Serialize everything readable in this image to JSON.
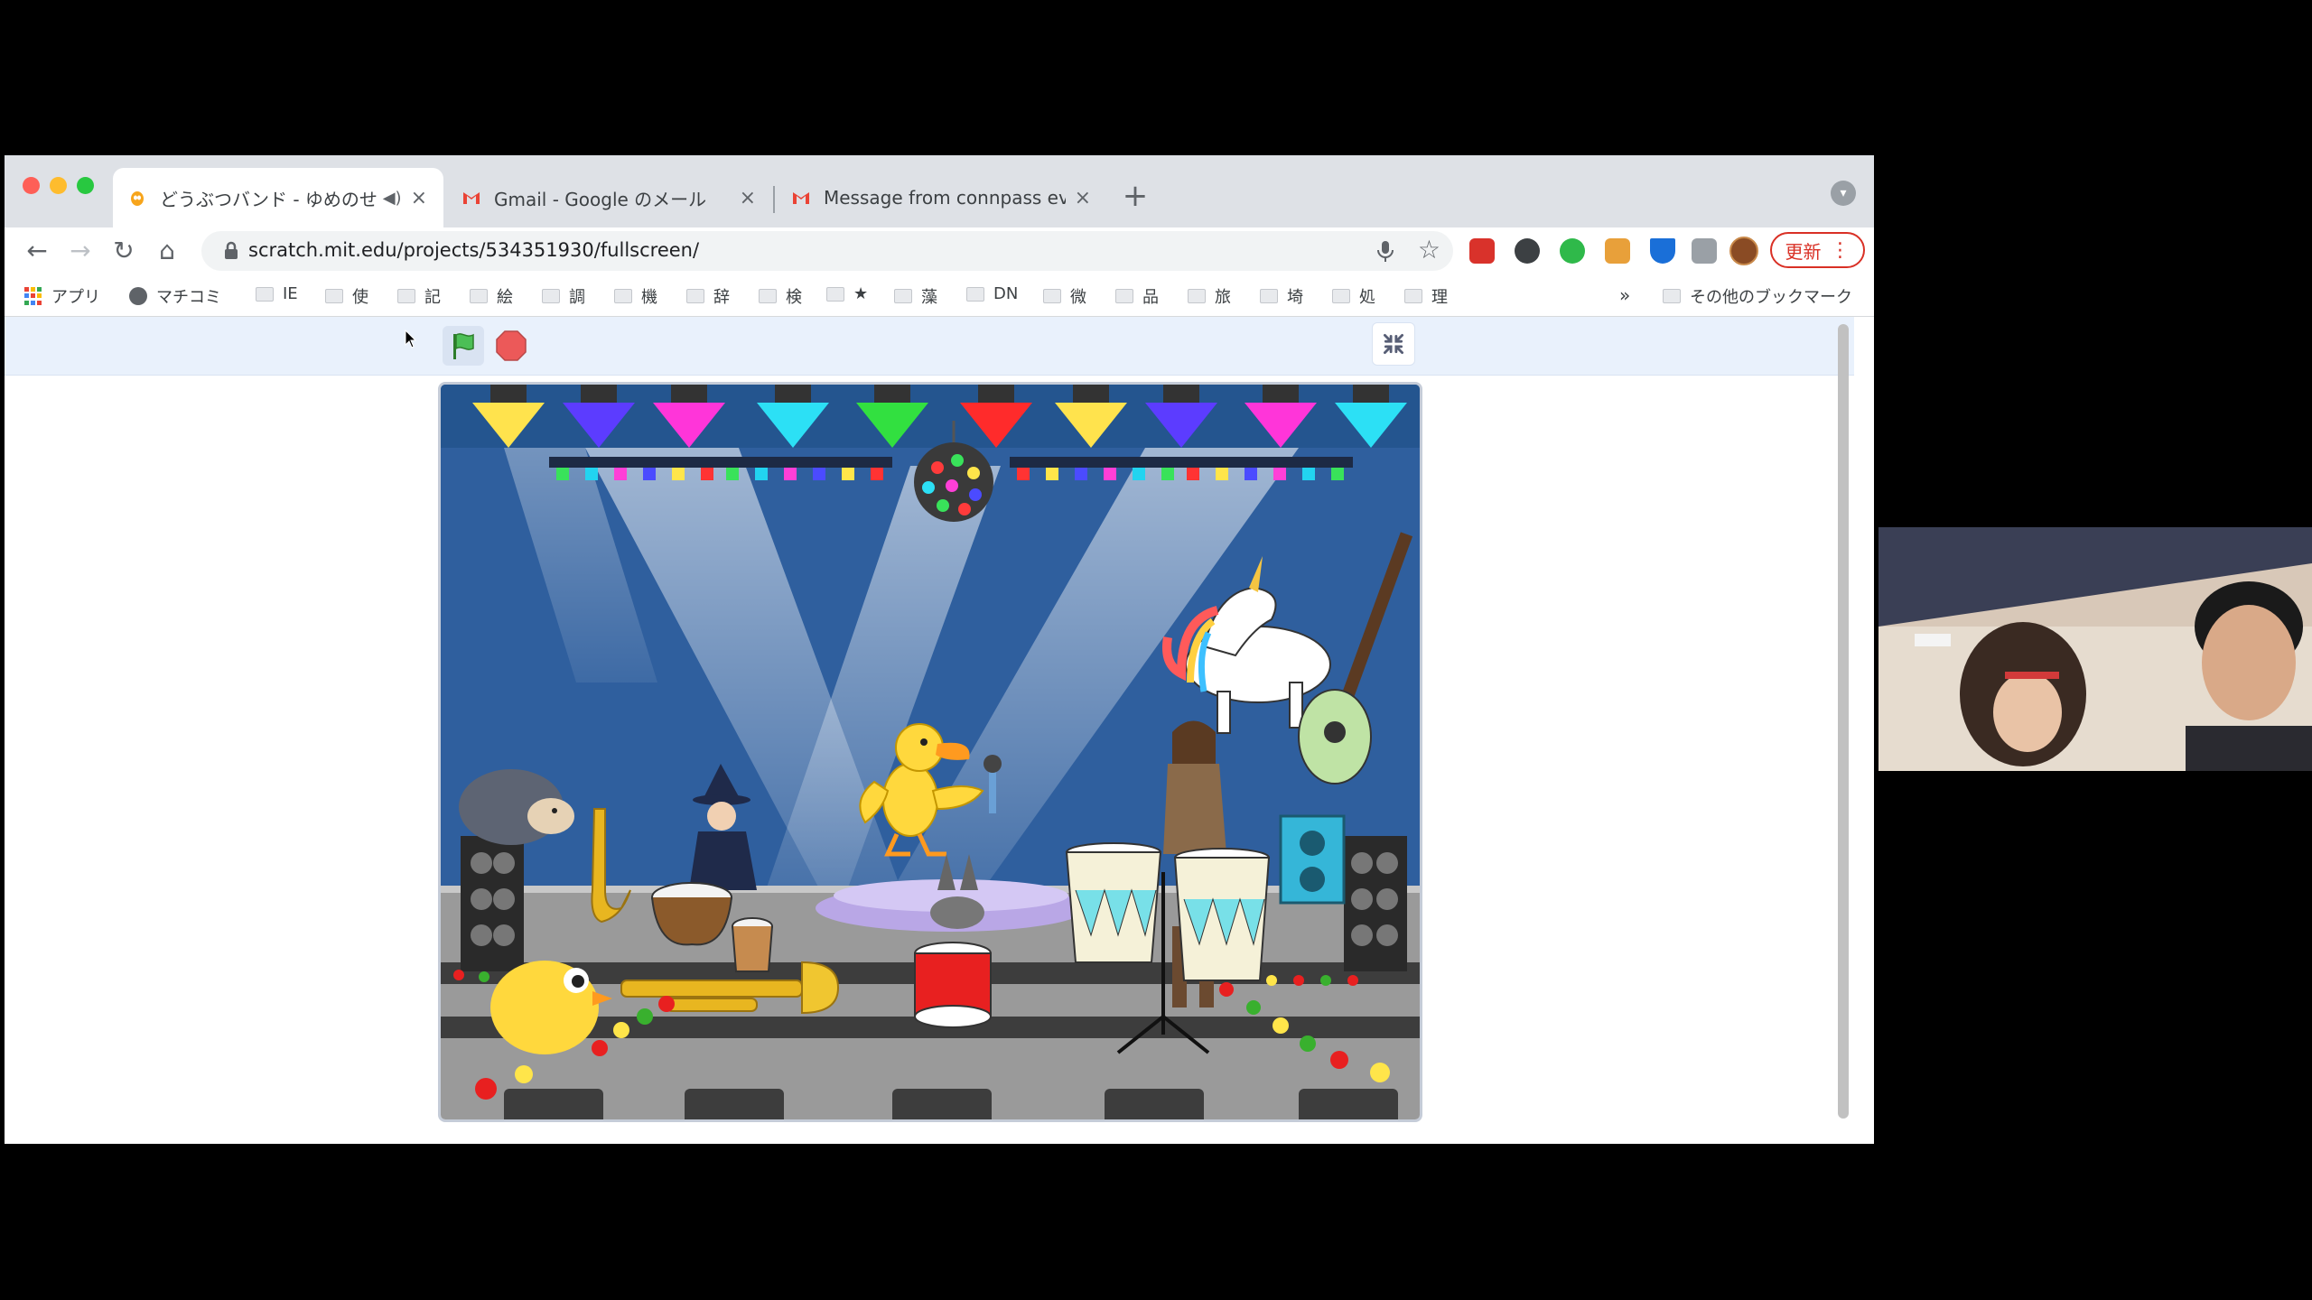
{
  "browser": {
    "tabs": [
      {
        "title": "どうぶつバンド - ゆめのせかい",
        "active": true,
        "favicon": "scratch-cat-icon",
        "audio": true
      },
      {
        "title": "Gmail - Google のメール",
        "active": false,
        "favicon": "gmail-icon"
      },
      {
        "title": "Message from connpass event",
        "active": false,
        "favicon": "gmail-icon"
      }
    ],
    "address": {
      "url": "scratch.mit.edu/projects/534351930/fullscreen/"
    },
    "update_label": "更新",
    "bookmarks": {
      "apps": "アプリ",
      "machicomi": "マチコミ",
      "items": [
        "IE",
        "使",
        "記",
        "絵",
        "調",
        "機",
        "辞",
        "検",
        "★",
        "藻",
        "DN",
        "微",
        "品",
        "旅",
        "埼",
        "処",
        "理"
      ],
      "overflow": "»",
      "other": "その他のブックマーク"
    }
  },
  "scratch": {
    "controls": [
      "green-flag",
      "stop",
      "exit-fullscreen"
    ]
  },
  "colors": {
    "accent_red": "#d93025",
    "stage_blue": "#2f5f9e",
    "stage_floor": "#9a9a9a"
  }
}
